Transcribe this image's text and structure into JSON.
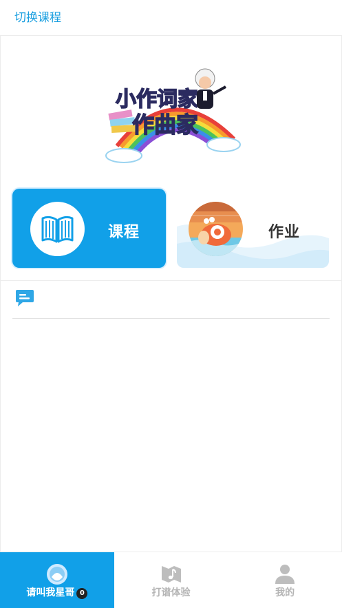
{
  "header": {
    "switch_course": "切换课程"
  },
  "cards": {
    "course": {
      "label": "课程",
      "color": "#11a0e8"
    },
    "homework": {
      "label": "作业"
    }
  },
  "tabs": [
    {
      "label": "请叫我星哥",
      "badge": "0",
      "icon": "avatar-icon",
      "active": true
    },
    {
      "label": "打谱体验",
      "icon": "music-note-icon",
      "active": false
    },
    {
      "label": "我的",
      "icon": "user-icon",
      "active": false
    }
  ],
  "colors": {
    "accent": "#11a0e8",
    "inactive": "#b5b5b5"
  }
}
